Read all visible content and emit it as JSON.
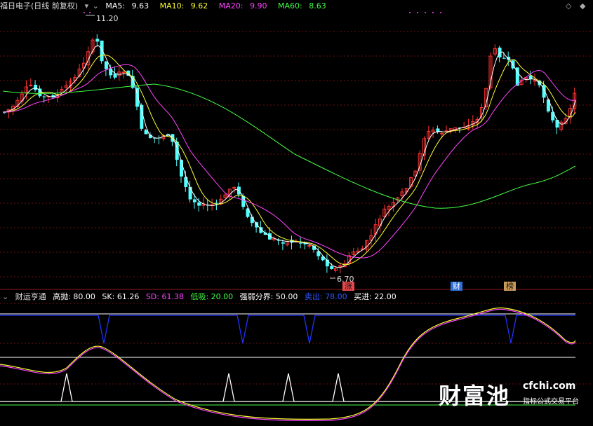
{
  "header": {
    "stock_title": "福日电子",
    "period_mode": "(日线 前复权)",
    "mode_dropdown_icon": "chevron-down-icon",
    "ma_dropdown_icon": "chevron-down-icon",
    "ma5": {
      "label": "MA5:",
      "value": "9.63",
      "color": "#ffffff"
    },
    "ma10": {
      "label": "MA10:",
      "value": "9.62",
      "color": "#ffff33"
    },
    "ma20": {
      "label": "MA20:",
      "value": "9.90",
      "color": "#ff44ff"
    },
    "ma60": {
      "label": "MA60:",
      "value": "8.63",
      "color": "#44ff44"
    }
  },
  "right_buttons": {
    "minus": "◇",
    "plus": "◆"
  },
  "price_annotations": {
    "high": "11.20",
    "low": "6.70"
  },
  "event_markers": [
    {
      "label": "涨",
      "color": "#e8474b"
    },
    {
      "label": "财",
      "color": "#2f6fd8"
    },
    {
      "label": "榜",
      "color": "#c89a5a"
    }
  ],
  "indicator_header": {
    "name": "财运亨通",
    "gao_pao": "高抛: 80.00",
    "sk": "SK: 61.26",
    "sd": "SD: 61.38",
    "di_xi": "低吸: 20.00",
    "qiang_ruo": "强弱分界: 50.00",
    "mai_chu": "卖出: 78.00",
    "mai_jin": "买进: 22.00"
  },
  "watermark": {
    "brand": "财富池",
    "url": "cfchi.com",
    "tagline": "指标公式交易平台"
  },
  "colors": {
    "up": "#ff3333",
    "down": "#54ffff",
    "grid": "#6b1010"
  }
}
